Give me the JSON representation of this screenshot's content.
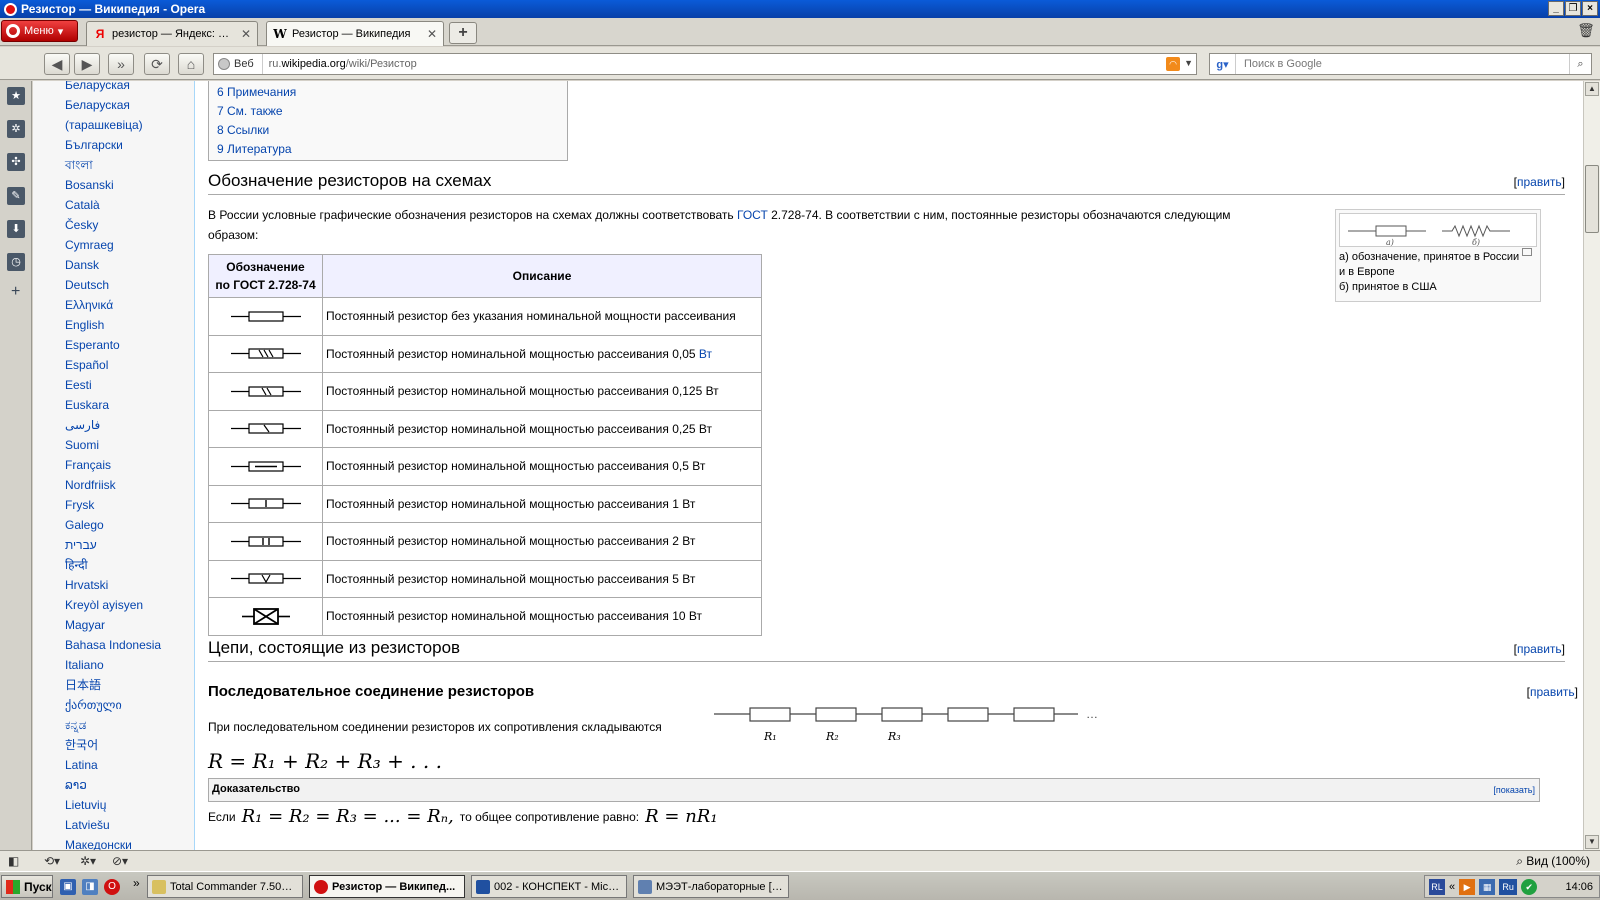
{
  "window": {
    "title": "Резистор — Википедия - Opera"
  },
  "tabs": {
    "menu_label": "Меню",
    "items": [
      {
        "label": "резистор — Яндекс: На...",
        "favicon": "Я"
      },
      {
        "label": "Резистор — Википедия",
        "favicon": "W"
      }
    ]
  },
  "address": {
    "chip": "Веб",
    "url_prefix": "ru.",
    "url_domain": "wikipedia.org",
    "url_path": "/wiki/Резистор",
    "search_placeholder": "Поиск в Google"
  },
  "languages": [
    "Беларуская",
    "Беларуская",
    "(тарашкевіца)",
    "Български",
    "বাংলা",
    "Bosanski",
    "Català",
    "Česky",
    "Cymraeg",
    "Dansk",
    "Deutsch",
    "Ελληνικά",
    "English",
    "Esperanto",
    "Español",
    "Eesti",
    "Euskara",
    "فارسی",
    "Suomi",
    "Français",
    "Nordfriisk",
    "Frysk",
    "Galego",
    "עברית",
    "हिन्दी",
    "Hrvatski",
    "Kreyòl ayisyen",
    "Magyar",
    "Bahasa Indonesia",
    "Italiano",
    "日本語",
    "ქართული",
    "ಕನ್ನಡ",
    "한국어",
    "Latina",
    "ລາວ",
    "Lietuvių",
    "Latviešu",
    "Македонски"
  ],
  "toc": [
    "6 Примечания",
    "7 См. также",
    "8 Ссылки",
    "9 Литература"
  ],
  "section1": {
    "title": "Обозначение резисторов на схемах",
    "edit_open": "[",
    "edit": "править",
    "edit_close": "]",
    "intro_a": "В России условные графические обозначения резисторов на схемах должны соответствовать ",
    "intro_link": "ГОСТ",
    "intro_b": " 2.728-74. В соответствии с ним, постоянные резисторы обозначаются следующим",
    "intro_c": "образом:"
  },
  "table": {
    "header_symbol_1": "Обозначение",
    "header_symbol_2": "по ГОСТ 2.728-74",
    "header_desc": "Описание",
    "rows": [
      {
        "desc": "Постоянный резистор без указания номинальной мощности рассеивания",
        "mark": ""
      },
      {
        "desc": "Постоянный резистор номинальной мощностью рассеивания 0,05 ",
        "unit_link": "Вт",
        "mark": "\\\\\\"
      },
      {
        "desc": "Постоянный резистор номинальной мощностью рассеивания 0,125 Вт",
        "mark": "\\\\"
      },
      {
        "desc": "Постоянный резистор номинальной мощностью рассеивания 0,25 Вт",
        "mark": "\\"
      },
      {
        "desc": "Постоянный резистор номинальной мощностью рассеивания 0,5 Вт",
        "mark": "—"
      },
      {
        "desc": "Постоянный резистор номинальной мощностью рассеивания 1 Вт",
        "mark": "I"
      },
      {
        "desc": "Постоянный резистор номинальной мощностью рассеивания 2 Вт",
        "mark": "II"
      },
      {
        "desc": "Постоянный резистор номинальной мощностью рассеивания 5 Вт",
        "mark": "V"
      },
      {
        "desc": "Постоянный резистор номинальной мощностью рассеивания 10 Вт",
        "mark": "X"
      }
    ]
  },
  "thumb": {
    "label_a": "а)",
    "label_b": "б)",
    "caption_1": "а) обозначение, принятое в России",
    "caption_2": "и в Европе",
    "caption_3": "б) принятое в США"
  },
  "section2": {
    "title": "Цепи, состоящие из резисторов",
    "edit": "править"
  },
  "section3": {
    "title": "Последовательное соединение резисторов",
    "edit": "править",
    "text": "При последовательном соединении резисторов их сопротивления складываются",
    "r_labels": [
      "R₁",
      "R₂",
      "R₃"
    ],
    "ellipsis": "…",
    "formula": "R = R₁ + R₂ + R₃ + . . .",
    "proof_title": "Доказательство",
    "proof_show": "[показать]",
    "if_word": "Если",
    "if_formula": "R₁ = R₂ = R₃ = ... = Rₙ,",
    "if_text": "то общее сопротивление равно:",
    "if_result": "R = nR₁"
  },
  "status": {
    "zoom": "Вид (100%)"
  },
  "taskbar": {
    "start": "Пуск",
    "items": [
      "Total Commander 7.50a ...",
      "Резистор — Википед...",
      "002 - КОНСПЕКТ - Micro...",
      "МЭЭТ-лабораторные [Р..."
    ],
    "lang": "Ru",
    "time": "14:06"
  }
}
